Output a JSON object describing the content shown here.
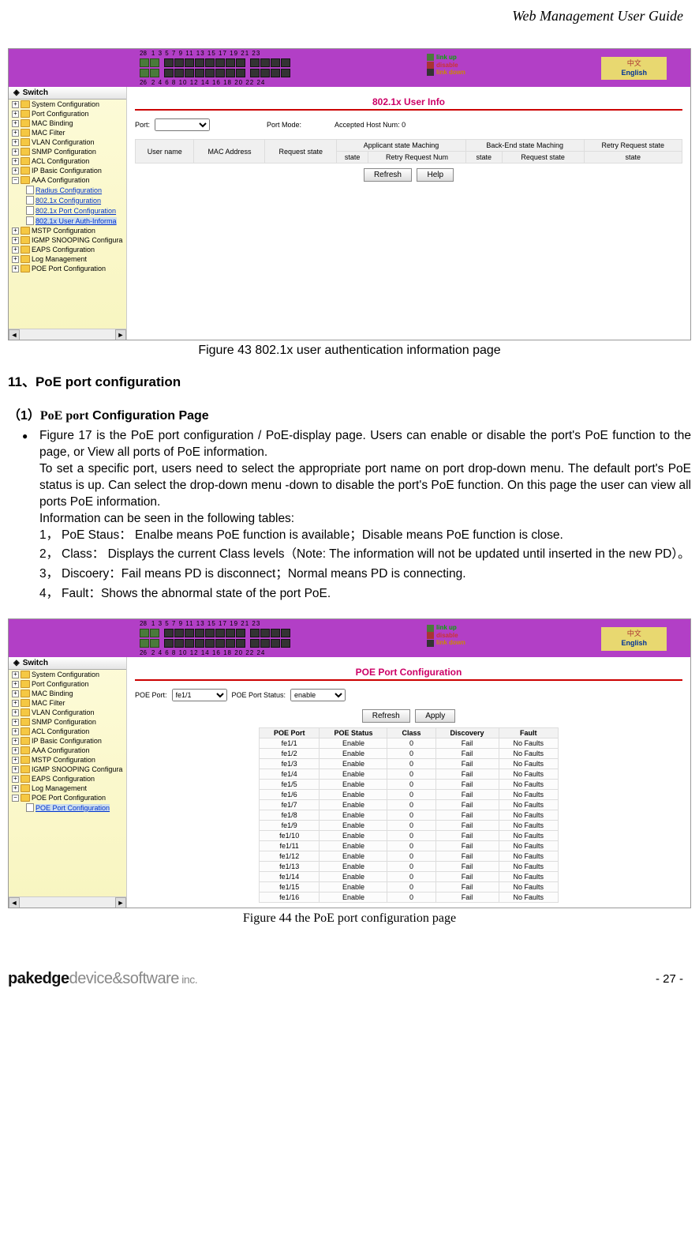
{
  "header": {
    "title": "Web Management User Guide"
  },
  "screenshot1": {
    "page_title": "802.1x User Info",
    "port_label": "Port:",
    "port_mode_label": "Port Mode:",
    "accepted_label": "Accepted Host Num: 0",
    "th_user": "User name",
    "th_mac": "MAC Address",
    "th_req": "Request state",
    "th_app": "Applicant state Maching",
    "th_back": "Back-End state Maching",
    "th_retry": "Retry Request state",
    "th_state": "state",
    "th_retry_num": "Retry Request Num",
    "btn_refresh": "Refresh",
    "btn_help": "Help",
    "legend": {
      "up": "link up",
      "disable": "disable",
      "down": "link down"
    },
    "lang": {
      "cn": "中文",
      "en": "English"
    },
    "sidebar_title": "Switch",
    "sidebar": [
      "System Configuration",
      "Port Configuration",
      "MAC Binding",
      "MAC Filter",
      "VLAN Configuration",
      "SNMP Configuration",
      "ACL Configuration",
      "IP Basic Configuration"
    ],
    "sidebar_aaa": "AAA Configuration",
    "sidebar_sub": [
      "Radius Configuration",
      "802.1x Configuration",
      "802.1x Port Configuration",
      "802.1x User Auth-Informa"
    ],
    "sidebar_after": [
      "MSTP Configuration",
      "IGMP SNOOPING Configura",
      "EAPS Configuration",
      "Log Management",
      "POE Port Configuration"
    ]
  },
  "caption1": "Figure 43 802.1x user authentication information page",
  "section_title": "11、PoE port configuration",
  "sub_title_prefix": "（1）",
  "sub_title_serif": "PoE port",
  "sub_title_rest": " Configuration Page",
  "body": {
    "p1": "Figure 17 is the PoE port configuration / PoE-display page. Users can enable or disable the port's PoE function to the page, or View all ports of PoE information.",
    "p2": "To set a specific port, users need to select the appropriate port name on port drop-down menu. The default port's PoE status is up. Can select the drop-down menu -down to disable the port's PoE function. On this page the user can view all ports PoE information.",
    "p3": "Information can be seen in the following tables:",
    "li1": "PoE Staus： Enalbe means PoE function is available；Disable means PoE function is close.",
    "li2": "Class： Displays the current Class levels（Note: The information will not be updated until inserted in the new PD）。",
    "li3": "Discoery：Fail means PD is disconnect；Normal means PD is connecting.",
    "li4": "Fault：Shows the abnormal state of the port PoE.",
    "n1": "1，",
    "n2": "2，",
    "n3": "3，",
    "n4": "4，"
  },
  "screenshot2": {
    "page_title": "POE Port Configuration",
    "poe_port_label": "POE Port:",
    "poe_port_val": "fe1/1",
    "poe_status_label": "POE Port Status:",
    "poe_status_val": "enable",
    "btn_refresh": "Refresh",
    "btn_apply": "Apply",
    "sidebar_title": "Switch",
    "sidebar": [
      "System Configuration",
      "Port Configuration",
      "MAC Binding",
      "MAC Filter",
      "VLAN Configuration",
      "SNMP Configuration",
      "ACL Configuration",
      "IP Basic Configuration",
      "AAA Configuration",
      "MSTP Configuration",
      "IGMP SNOOPING Configura",
      "EAPS Configuration",
      "Log Management"
    ],
    "sidebar_poe": "POE Port Configuration",
    "sidebar_sub": "POE Port Configuration",
    "th": {
      "port": "POE Port",
      "status": "POE Status",
      "class": "Class",
      "disc": "Discovery",
      "fault": "Fault"
    },
    "rows": [
      {
        "p": "fe1/1",
        "s": "Enable",
        "c": "0",
        "d": "Fail",
        "f": "No Faults"
      },
      {
        "p": "fe1/2",
        "s": "Enable",
        "c": "0",
        "d": "Fail",
        "f": "No Faults"
      },
      {
        "p": "fe1/3",
        "s": "Enable",
        "c": "0",
        "d": "Fail",
        "f": "No Faults"
      },
      {
        "p": "fe1/4",
        "s": "Enable",
        "c": "0",
        "d": "Fail",
        "f": "No Faults"
      },
      {
        "p": "fe1/5",
        "s": "Enable",
        "c": "0",
        "d": "Fail",
        "f": "No Faults"
      },
      {
        "p": "fe1/6",
        "s": "Enable",
        "c": "0",
        "d": "Fail",
        "f": "No Faults"
      },
      {
        "p": "fe1/7",
        "s": "Enable",
        "c": "0",
        "d": "Fail",
        "f": "No Faults"
      },
      {
        "p": "fe1/8",
        "s": "Enable",
        "c": "0",
        "d": "Fail",
        "f": "No Faults"
      },
      {
        "p": "fe1/9",
        "s": "Enable",
        "c": "0",
        "d": "Fail",
        "f": "No Faults"
      },
      {
        "p": "fe1/10",
        "s": "Enable",
        "c": "0",
        "d": "Fail",
        "f": "No Faults"
      },
      {
        "p": "fe1/11",
        "s": "Enable",
        "c": "0",
        "d": "Fail",
        "f": "No Faults"
      },
      {
        "p": "fe1/12",
        "s": "Enable",
        "c": "0",
        "d": "Fail",
        "f": "No Faults"
      },
      {
        "p": "fe1/13",
        "s": "Enable",
        "c": "0",
        "d": "Fail",
        "f": "No Faults"
      },
      {
        "p": "fe1/14",
        "s": "Enable",
        "c": "0",
        "d": "Fail",
        "f": "No Faults"
      },
      {
        "p": "fe1/15",
        "s": "Enable",
        "c": "0",
        "d": "Fail",
        "f": "No Faults"
      },
      {
        "p": "fe1/16",
        "s": "Enable",
        "c": "0",
        "d": "Fail",
        "f": "No Faults"
      }
    ]
  },
  "caption2": "Figure 44 the PoE port configuration page",
  "footer": {
    "logo_bold": "pakedge",
    "logo_light1": "device&software",
    "logo_light2": " inc.",
    "page": "- 27 -"
  },
  "topbar_ports": {
    "odd": "1   3   5   7   9  11 13 15    17 19 21 23",
    "even": "2   4   6   8  10 12 14 16    18 20 22 24",
    "lead1": "28",
    "lead2": "26"
  }
}
